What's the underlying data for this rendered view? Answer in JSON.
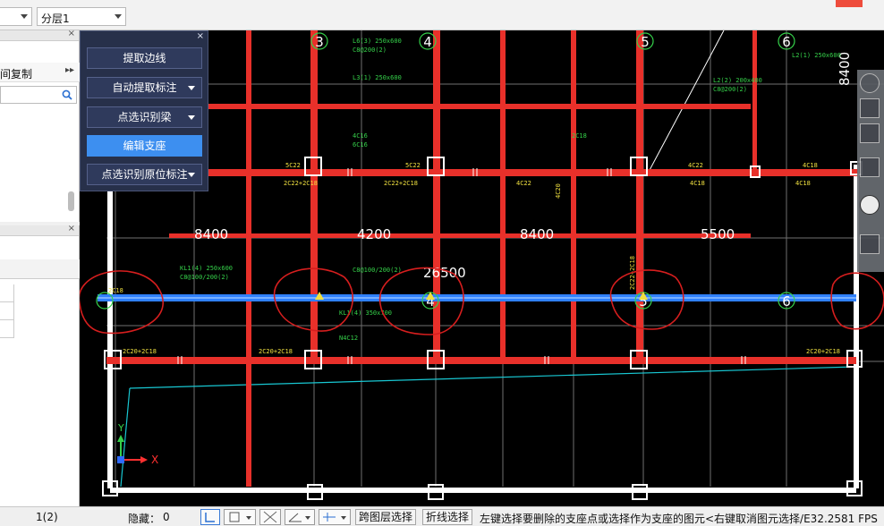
{
  "toolbar": {
    "combo_left_value": "",
    "floor_combo_value": "分层1"
  },
  "left_panel": {
    "copy_label": "间复制",
    "expand_glyph": "▸▸",
    "search_icon": "search-icon"
  },
  "tool_panel": {
    "close": "×",
    "buttons": [
      {
        "label": "提取边线",
        "dropdown": false
      },
      {
        "label": "自动提取标注",
        "dropdown": true
      },
      {
        "label": "点选识别梁",
        "dropdown": true
      },
      {
        "label": "编辑支座",
        "dropdown": false
      },
      {
        "label": "点选识别原位标注",
        "dropdown": true
      }
    ]
  },
  "drawing": {
    "axis_top": [
      "3",
      "4",
      "5",
      "6"
    ],
    "axis_mid": [
      "4",
      "5",
      "6"
    ],
    "dims": [
      "8400",
      "4200",
      "8400",
      "5500",
      "26500",
      "8400"
    ],
    "beam_marks_red": [
      "5C22",
      "5C22",
      "4C22",
      "4C18",
      "4C18",
      "4C22",
      "2C22+2C18",
      "2C22+2C18",
      "2C20+2C18",
      "2C20+2C18",
      "4C20",
      "2C22+2C18",
      "2C20+2C18",
      "4C18",
      "2C18"
    ],
    "beam_marks_green": [
      "L6(3) 250x600",
      "C8@200(2)",
      "KL1(4) 250x600",
      "C8@100/200(2)",
      "C8@100/200(2)",
      "KL1(4) 350x700",
      "N4C12",
      "4C16",
      "6C16",
      "L2(1) 250x600",
      "L2(2) 200x400",
      "C8@200(2)",
      "L3(1) 250x600",
      "2C18"
    ],
    "axis_x_label": "X",
    "axis_y_label": "Y"
  },
  "status": {
    "coord": "1(2)",
    "hidden_label": "隐藏：",
    "hidden_count": "0",
    "cross_layer_select": "跨图层选择",
    "polyline_select": "折线选择",
    "hint": "左键选择要删除的支座点或选择作为支座的图元<右键取消图元选择/E32.2581 FPS"
  },
  "colors": {
    "canvas_bg": "#000000",
    "beam_red": "#e8302a",
    "beam_selected": "#2f80ff",
    "wall_white": "#ffffff",
    "grid_gray": "#7a7a7a",
    "text_green": "#35d14a",
    "text_yellow": "#f0e040",
    "annotation_red": "#d61e1e",
    "panel_bg": "#27304a",
    "primary_button": "#3d8ff0"
  }
}
